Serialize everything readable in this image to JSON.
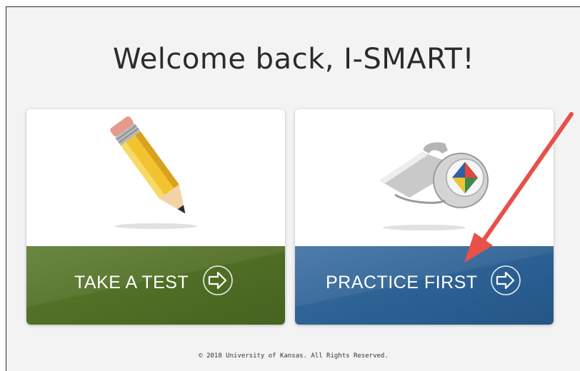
{
  "page": {
    "welcome_title": "Welcome back, I-SMART!",
    "footer_text": "© 2018 University of Kansas. All Rights Reserved."
  },
  "cards": [
    {
      "label": "TAKE A TEST",
      "icon": "pencil-icon",
      "band_color": "#4f6d24",
      "action_icon": "arrow-right-circle-icon"
    },
    {
      "label": "PRACTICE FIRST",
      "icon": "whistle-icon",
      "band_color": "#2c6093",
      "action_icon": "arrow-right-circle-icon"
    }
  ],
  "annotation": {
    "icon": "red-pointer-arrow",
    "color": "#e8504a"
  }
}
